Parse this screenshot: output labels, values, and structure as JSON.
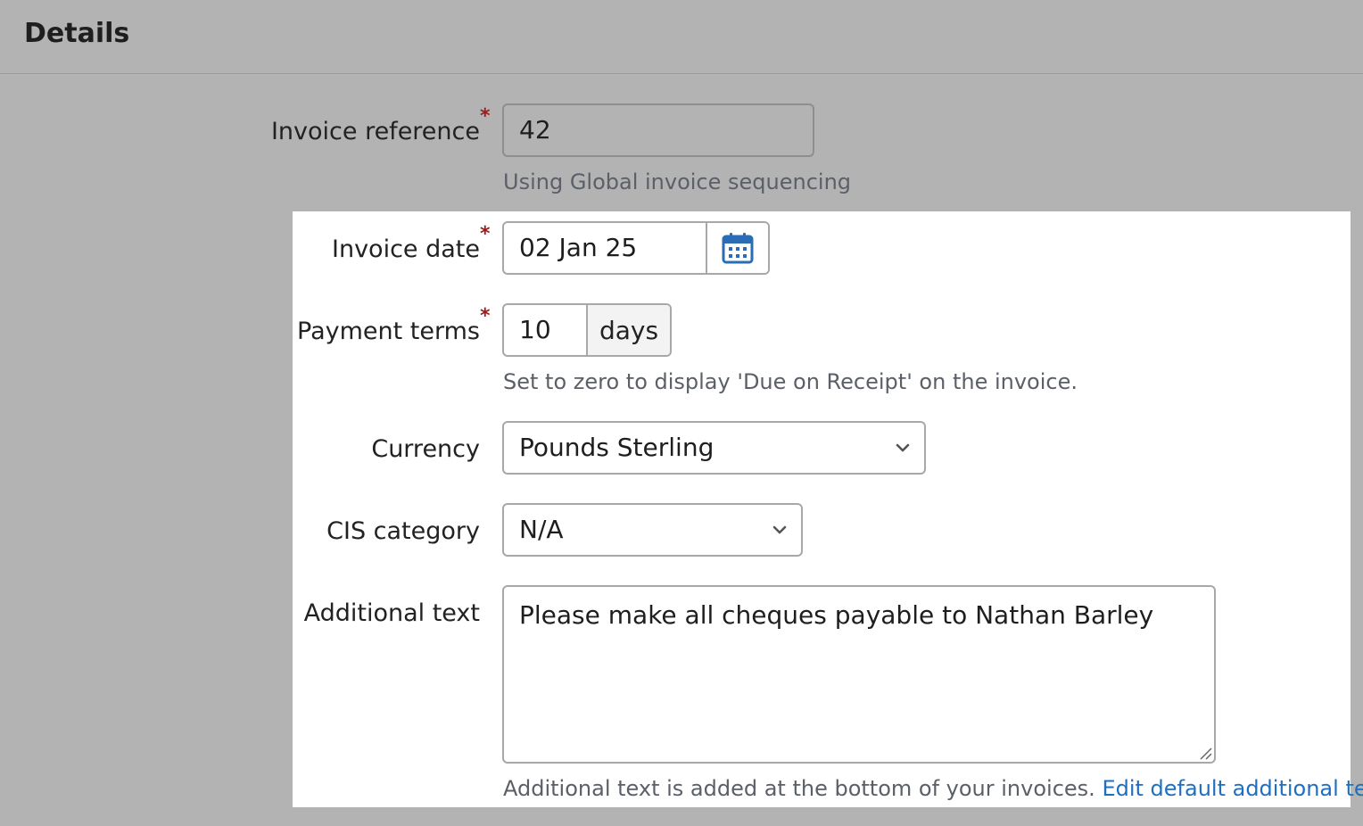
{
  "header": {
    "title": "Details"
  },
  "form": {
    "invoice_reference": {
      "label": "Invoice reference",
      "required_mark": "*",
      "value": "42",
      "help": "Using Global invoice sequencing"
    },
    "invoice_date": {
      "label": "Invoice date",
      "required_mark": "*",
      "value": "02 Jan 25",
      "button_icon": "calendar-icon"
    },
    "payment_terms": {
      "label": "Payment terms",
      "required_mark": "*",
      "value": "10",
      "unit": "days",
      "help": "Set to zero to display 'Due on Receipt' on the invoice."
    },
    "currency": {
      "label": "Currency",
      "selected": "Pounds Sterling",
      "icon": "chevron-down-icon"
    },
    "cis_category": {
      "label": "CIS category",
      "selected": "N/A",
      "icon": "chevron-down-icon"
    },
    "additional_text": {
      "label": "Additional text",
      "value": "Please make all cheques payable to Nathan Barley",
      "help": "Additional text is added at the bottom of your invoices.",
      "link": "Edit default additional text"
    }
  },
  "colors": {
    "background_dimmed": "#b3b3b3",
    "highlight": "#ffffff",
    "required": "#9b1c1c",
    "link": "#1f6fbf",
    "calendar_icon": "#2a6db5"
  }
}
